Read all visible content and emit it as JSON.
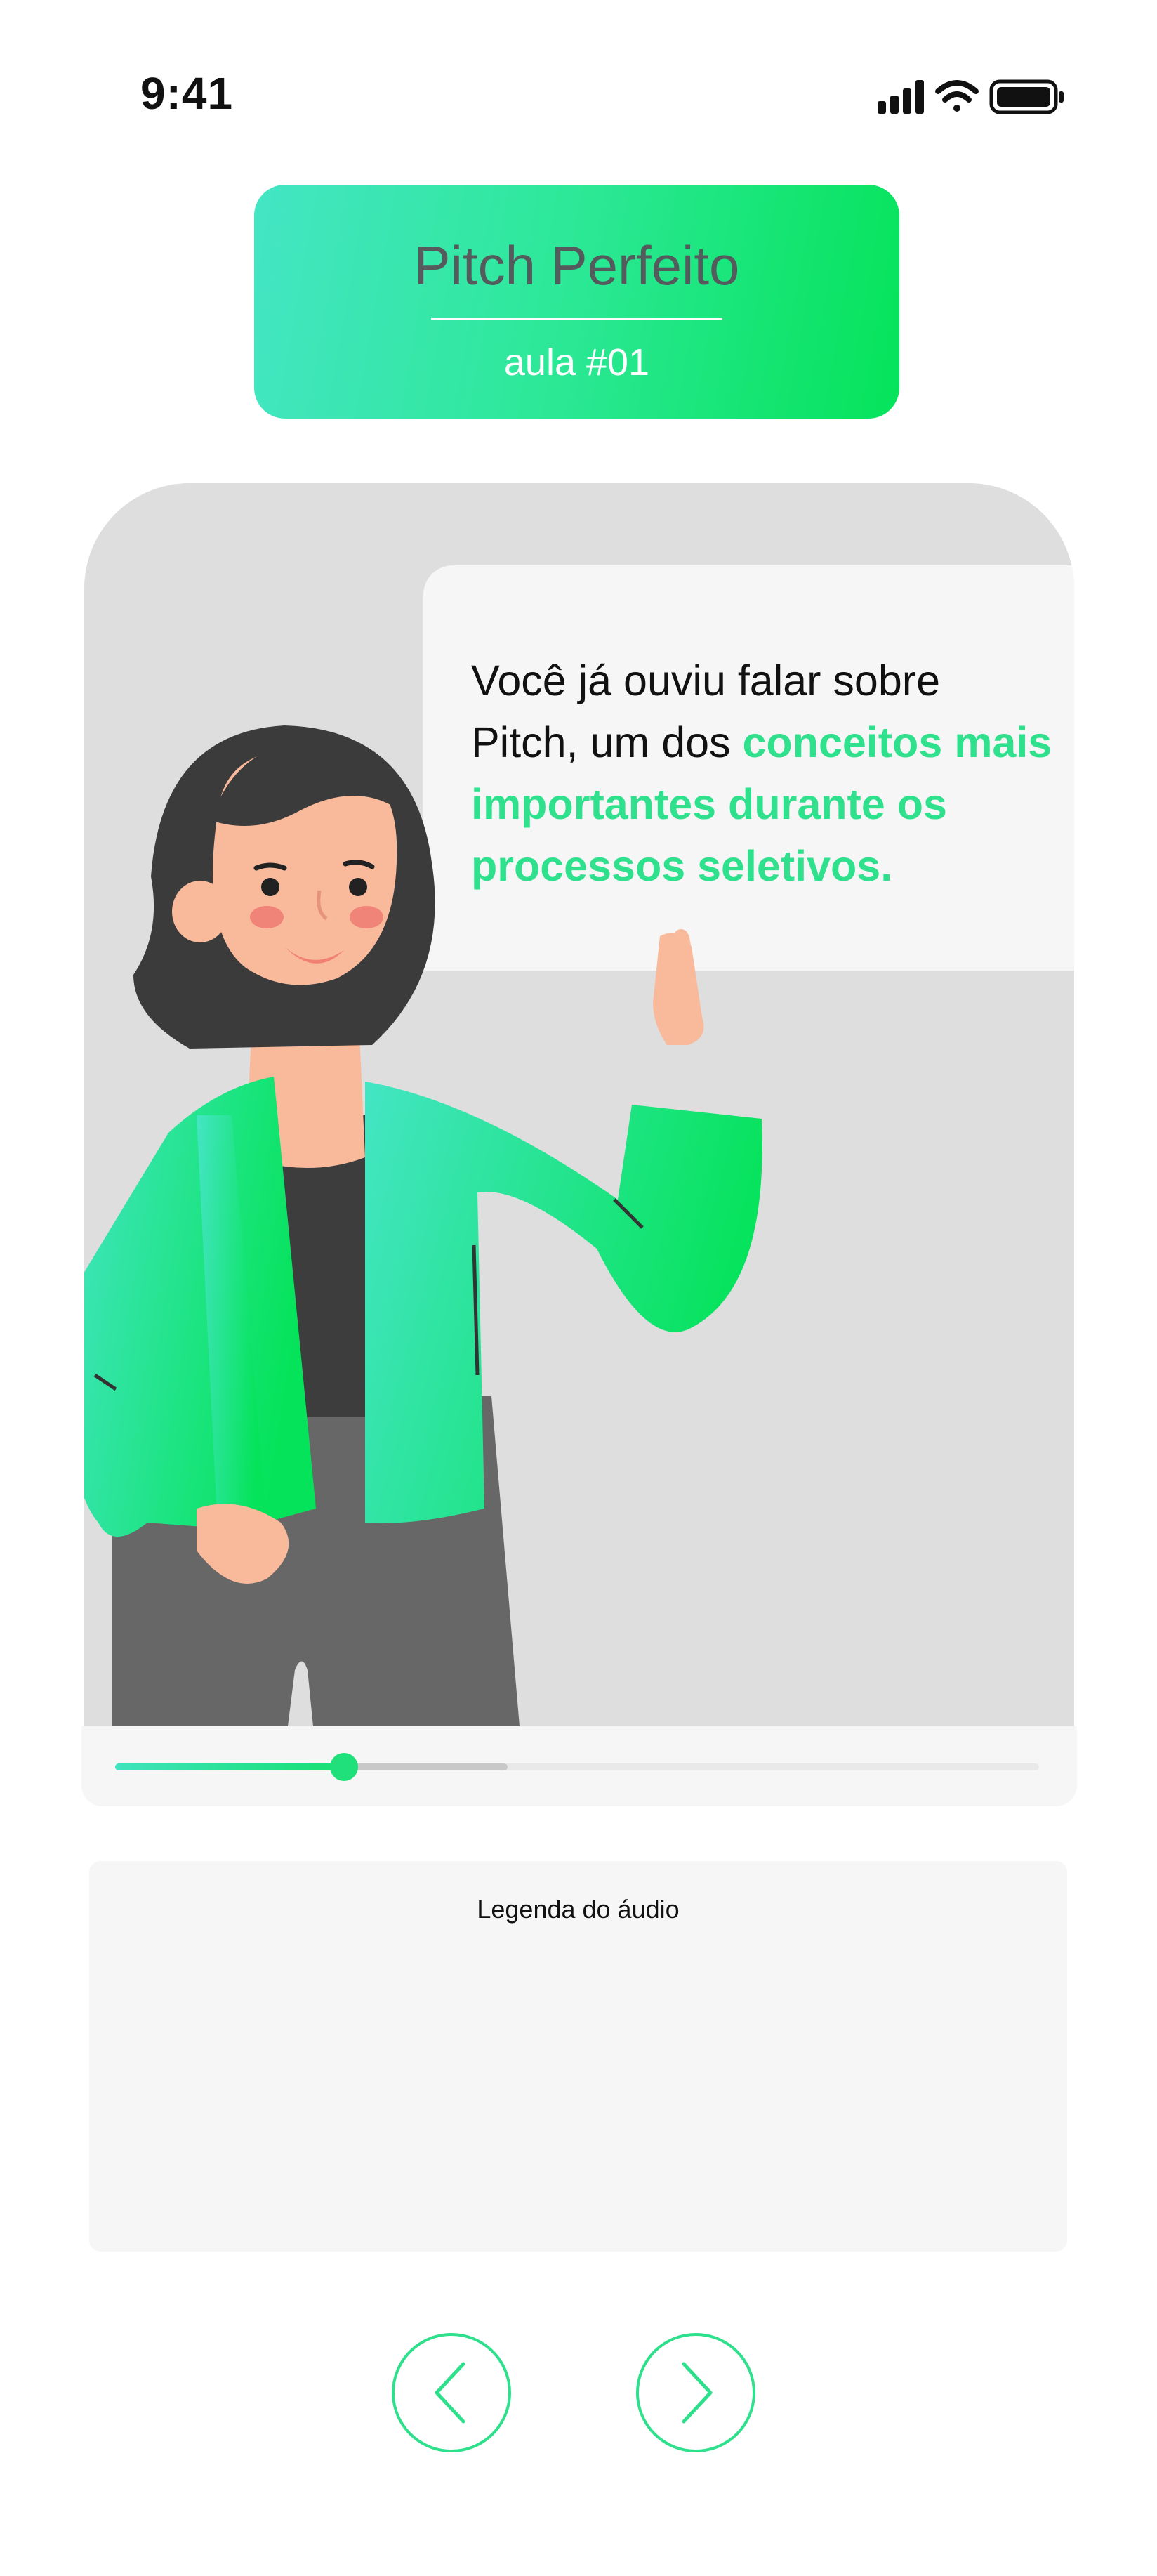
{
  "status_bar": {
    "time": "9:41"
  },
  "header": {
    "title": "Pitch Perfeito",
    "lesson": "aula #01"
  },
  "lesson": {
    "speech": {
      "line_plain": "Você já ouviu falar sobre Pitch, um dos ",
      "line_highlight": "conceitos mais importantes durante os processos seletivos."
    }
  },
  "player": {
    "progress": 0.248,
    "buffered": 0.425
  },
  "caption": {
    "label": "Legenda do áudio"
  },
  "navigation": {
    "prev_icon": "chevron-left-icon",
    "next_icon": "chevron-right-icon"
  },
  "colors": {
    "accent": "#2fe08c",
    "accent_teal": "#44e5c4",
    "accent_green": "#05e35a",
    "gray_panel": "#dedede"
  }
}
